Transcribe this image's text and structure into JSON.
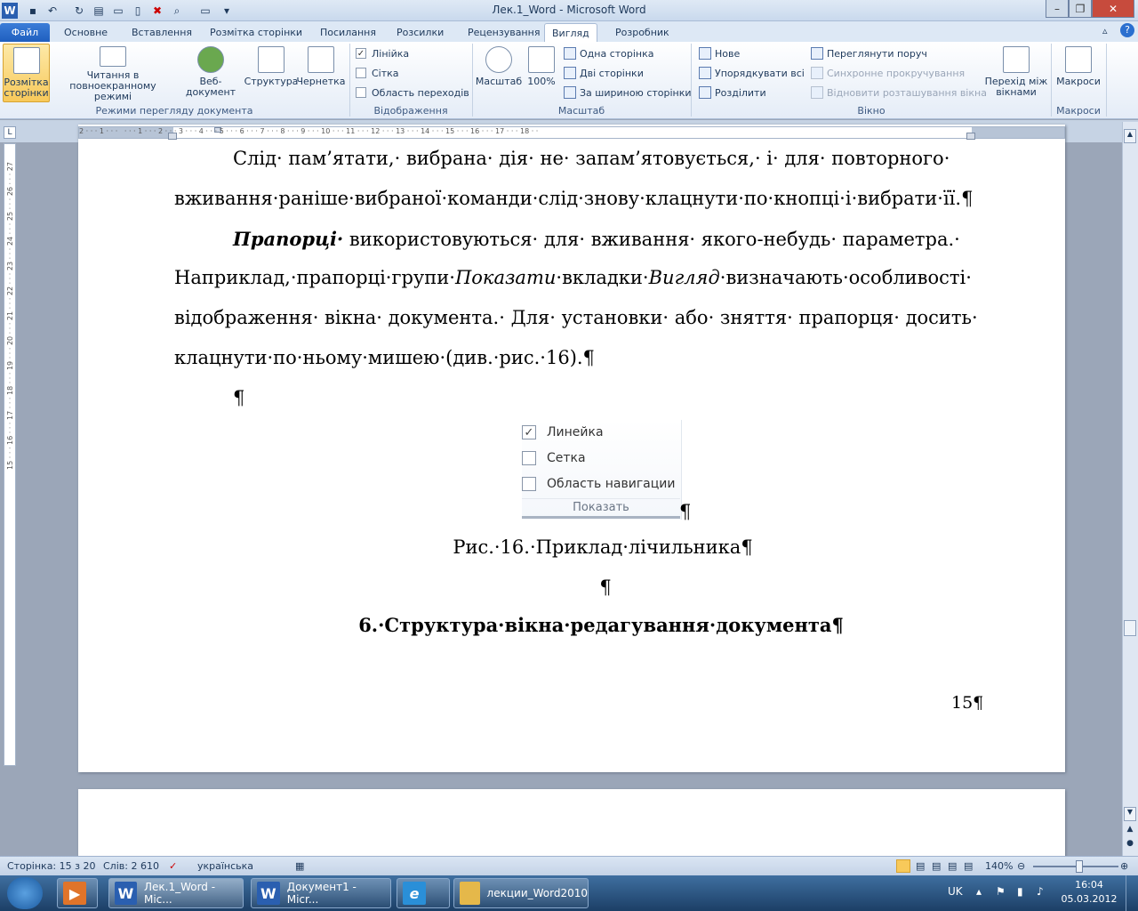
{
  "window": {
    "title": "Лек.1_Word  -  Microsoft Word"
  },
  "tabs": [
    "Файл",
    "Основне",
    "Вставлення",
    "Розмітка сторінки",
    "Посилання",
    "Розсилки",
    "Рецензування",
    "Вигляд",
    "Розробник"
  ],
  "ribbon": {
    "views": {
      "print_layout": "Розмітка сторінки",
      "full_screen_1": "Читання в",
      "full_screen_2": "повноекранному режимі",
      "web": "Веб-документ",
      "outline": "Структура",
      "draft": "Чернетка",
      "group": "Режими перегляду документа"
    },
    "show": {
      "ruler": "Лінійка",
      "gridlines": "Сітка",
      "nav_pane": "Область переходів",
      "group": "Відображення"
    },
    "zoom": {
      "zoom": "Масштаб",
      "percent": "100%",
      "one_page": "Одна сторінка",
      "two_pages": "Дві сторінки",
      "page_width": "За шириною сторінки",
      "group": "Масштаб"
    },
    "window": {
      "new": "Нове",
      "arrange": "Упорядкувати всі",
      "split": "Розділити",
      "side_by_side": "Переглянути поруч",
      "sync_scroll": "Синхронне прокручування",
      "reset_pos": "Відновити розташування вікна",
      "switch_1": "Перехід між",
      "switch_2": "вікнами",
      "group": "Вікно"
    },
    "macros": {
      "macros": "Макроси",
      "group": "Макроси"
    }
  },
  "document": {
    "p1_l1": "Слід· пам’ятати,· вибрана· дія· не· запам’ятовується,· і· для· повторного·",
    "p1_l2": "вживання·раніше·вибраної·команди·слід·знову·клацнути·по·кнопці·і·вибрати·її.¶",
    "p2_l1_bold": "Прапорці·",
    "p2_l1_rest": " використовуються· для· вживання· якого-небудь· параметра.·",
    "p2_l2_a": "Наприклад,·прапорці·групи·",
    "p2_l2_b": "Показати",
    "p2_l2_c": "·вкладки·",
    "p2_l2_d": "Вигляд",
    "p2_l2_e": "·визначають·особливості·",
    "p2_l3": "відображення· вікна· документа.· Для· установки· або· зняття· прапорця· досить·",
    "p2_l4": "клацнути·по·ньому·мишею·(див.·рис.·16).¶",
    "empty_para": "¶",
    "fig": {
      "ruler": "Линейка",
      "grid": "Сетка",
      "nav": "Область навигации",
      "group": "Показать",
      "pilcrow": "¶"
    },
    "caption": "Рис.·16.·Приклад·лічильника¶",
    "empty_para2": "¶",
    "heading": "6.·Структура·вікна·редагування·документа¶",
    "page_number": "15¶"
  },
  "statusbar": {
    "page": "Сторінка: 15 з 20",
    "words": "Слів: 2 610",
    "language": "українська",
    "zoom": "140%"
  },
  "taskbar": {
    "items": [
      "Лек.1_Word - Mic...",
      "Документ1 - Micr...",
      "лекции_Word2010"
    ],
    "lang": "UK",
    "time": "16:04",
    "date": "05.03.2012"
  },
  "colors": {
    "file_tab": "#2b6fcf",
    "active_view": "#f8c95a",
    "taskbar": "#1c3f66"
  }
}
